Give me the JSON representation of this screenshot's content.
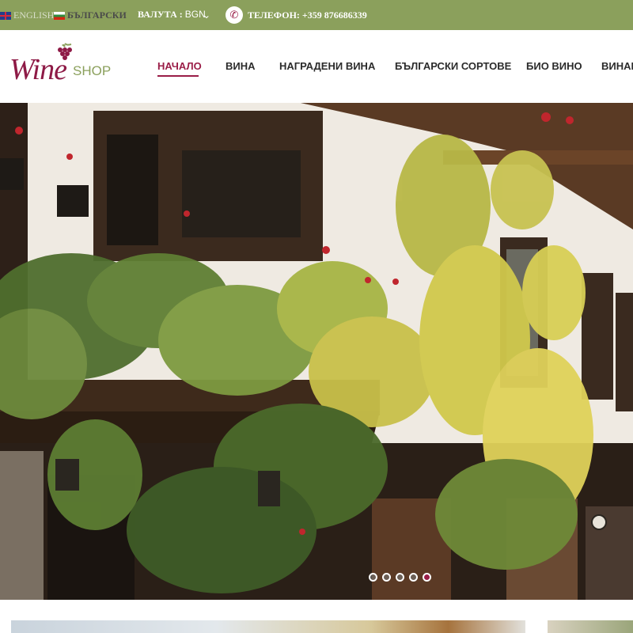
{
  "topbar": {
    "lang_en": "ENGLISH",
    "lang_bg": "БЪЛГАРСКИ",
    "currency_label": "ВАЛУТА :",
    "currency_value": "BGN",
    "phone": "ТЕЛЕФОН: +359 876686339"
  },
  "logo": {
    "wine": "Wine",
    "shop": "SHOP"
  },
  "nav": {
    "items": [
      {
        "label": "НАЧАЛО"
      },
      {
        "label": "ВИНА"
      },
      {
        "label": "НАГРАДЕНИ ВИНА"
      },
      {
        "label": "БЪЛГАРСКИ СОРТОВЕ"
      },
      {
        "label": "БИО ВИНО"
      },
      {
        "label": "ВИНАР"
      }
    ],
    "active_index": 0
  },
  "slider": {
    "slides": 5,
    "active_slide": 5
  },
  "colors": {
    "topbar": "#8ba05c",
    "accent": "#9a1d47",
    "logo_green": "#8ba05c"
  },
  "icons": [
    "flag-uk-icon",
    "flag-bg-icon",
    "chevron-down-icon",
    "phone-icon",
    "grapes-icon"
  ]
}
